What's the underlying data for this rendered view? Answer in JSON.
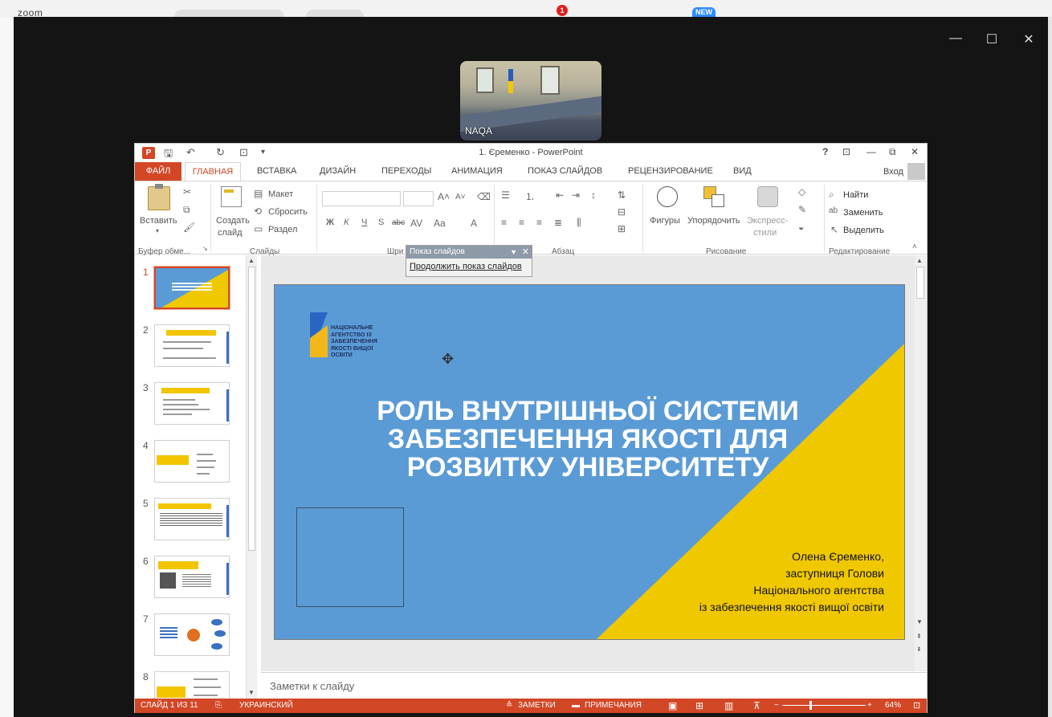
{
  "desktop": {
    "app_label": "zoom",
    "notification_count": "1",
    "new_badge": "NEW"
  },
  "zoom_window": {
    "participant_name": "NAQA",
    "controls": {
      "minimize": "—",
      "maximize": "☐",
      "close": "✕"
    }
  },
  "ppt": {
    "title": "1. Єременко - PowerPoint",
    "title_controls": {
      "help": "?",
      "restore_ribbon": "⊡",
      "minimize": "—",
      "maximize": "⧉",
      "close": "✕"
    },
    "signin": "Вход",
    "tabs": {
      "file": "ФАЙЛ",
      "home": "ГЛАВНАЯ",
      "insert": "ВСТАВКА",
      "design": "ДИЗАЙН",
      "transitions": "ПЕРЕХОДЫ",
      "animations": "АНИМАЦИЯ",
      "slideshow": "ПОКАЗ СЛАЙДОВ",
      "review": "РЕЦЕНЗИРОВАНИЕ",
      "view": "ВИД"
    },
    "ribbon": {
      "paste": "Вставить",
      "new_slide_1": "Создать",
      "new_slide_2": "слайд",
      "layout": "Макет",
      "reset": "Сбросить",
      "section": "Раздел",
      "clipboard_group": "Буфер обме...",
      "slides_group": "Слайды",
      "font_group": "Шри",
      "paragraph_group": "Абзац",
      "drawing_group": "Рисование",
      "editing_group": "Редактирование",
      "shapes": "Фигуры",
      "arrange": "Упорядочить",
      "quick_styles_1": "Экспресс-",
      "quick_styles_2": "стили",
      "find": "Найти",
      "replace": "Заменить",
      "select": "Выделить",
      "bold": "Ж",
      "italic": "К",
      "underline": "Ч",
      "strike": "S",
      "abc": "abc"
    },
    "thumbnails": [
      {
        "num": "1"
      },
      {
        "num": "2"
      },
      {
        "num": "3"
      },
      {
        "num": "4"
      },
      {
        "num": "5"
      },
      {
        "num": "6"
      },
      {
        "num": "7"
      },
      {
        "num": "8"
      }
    ],
    "slide": {
      "logo_text": "НАЦІОНАЛЬНЕ АГЕНТСТВО ІЗ ЗАБЕЗПЕЧЕННЯ ЯКОСТІ ВИЩОЇ ОСВІТИ",
      "title": "РОЛЬ ВНУТРІШНЬОЇ СИСТЕМИ ЗАБЕЗПЕЧЕННЯ ЯКОСТІ ДЛЯ РОЗВИТКУ УНІВЕРСИТЕТУ",
      "author_lines": [
        "Олена Єременко,",
        "заступниця Голови",
        "Національного агентства",
        "із забезпечення якості вищої освіти"
      ]
    },
    "notes_placeholder": "Заметки к слайду",
    "slideshow_toolbar": {
      "title": "Показ слайдов",
      "continue": "Продолжить показ слайдов"
    },
    "status": {
      "slide_info": "СЛАЙД 1 ИЗ 11",
      "language": "УКРАИНСКИЙ",
      "notes": "ЗАМЕТКИ",
      "comments": "ПРИМЕЧАНИЯ",
      "zoom_level": "64%",
      "zoom_minus": "−",
      "zoom_plus": "+"
    }
  },
  "colors": {
    "ppt_accent": "#d24726",
    "slide_blue": "#5b9bd5",
    "slide_yellow": "#f0c800"
  }
}
